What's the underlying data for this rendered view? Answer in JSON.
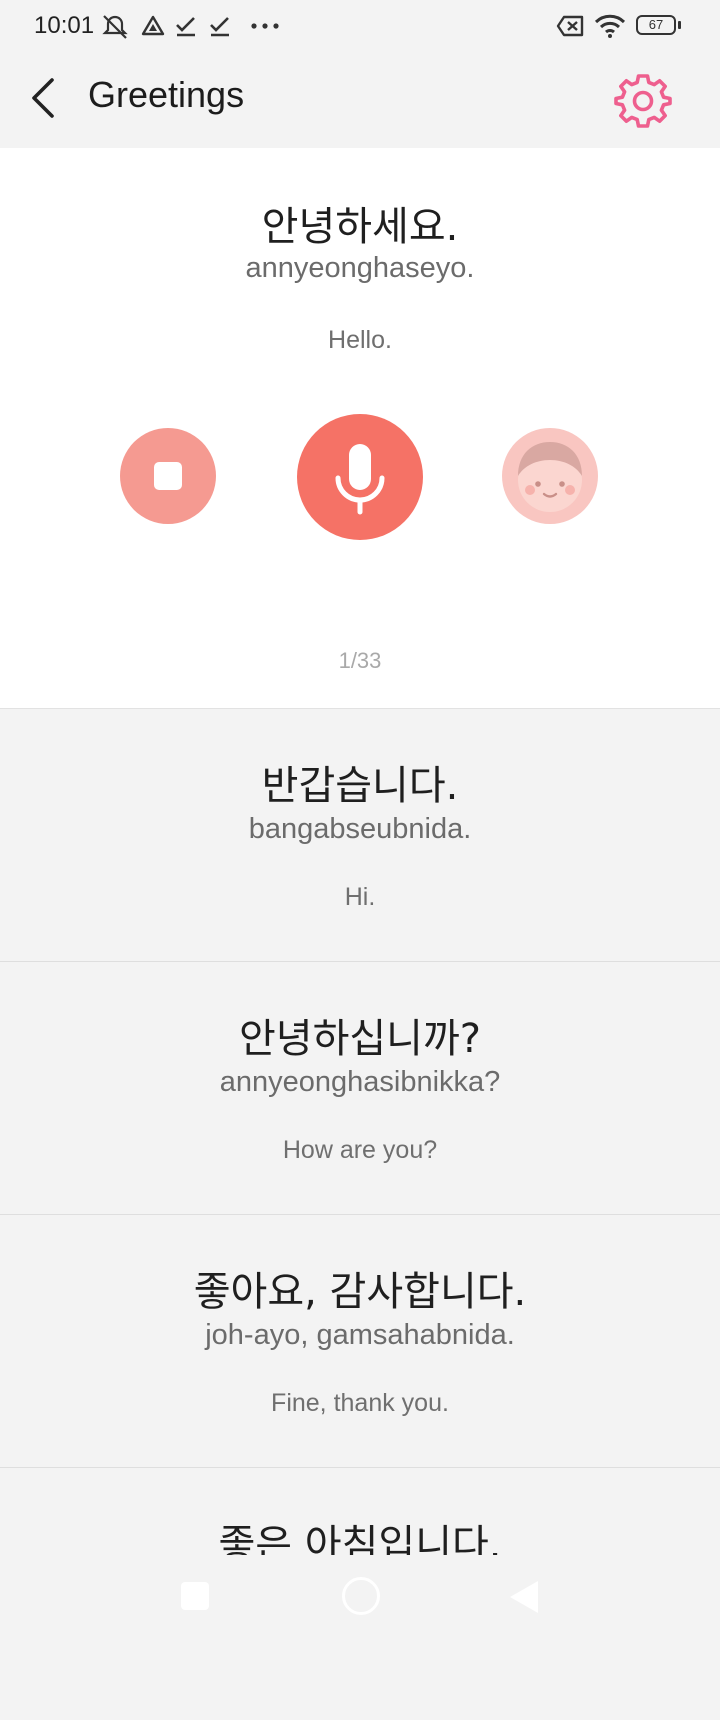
{
  "status_bar": {
    "time": "10:01",
    "battery": "67",
    "icons": [
      "mute-icon",
      "drive-icon",
      "check-icon",
      "check-icon",
      "more-icon",
      "sim-off-icon",
      "wifi-icon",
      "battery-icon"
    ]
  },
  "header": {
    "title": "Greetings",
    "back_icon": "chevron-left-icon",
    "settings_icon": "gear-icon"
  },
  "colors": {
    "accent_pink": "#ee5f8e",
    "stop_button": "#f59a91",
    "mic_button": "#f57266",
    "voice_button": "#f9c6c1"
  },
  "active_phrase": {
    "korean": "안녕하세요.",
    "romanization": "annyeonghaseyo.",
    "english": "Hello.",
    "counter": "1/33",
    "controls": [
      "stop-icon",
      "microphone-icon",
      "avatar-icon"
    ]
  },
  "phrases": [
    {
      "korean": "반갑습니다.",
      "romanization": "bangabseubnida.",
      "english": "Hi."
    },
    {
      "korean": "안녕하십니까?",
      "romanization": "annyeonghasibnikka?",
      "english": "How are you?"
    },
    {
      "korean": "좋아요, 감사합니다.",
      "romanization": "joh-ayo, gamsahabnida.",
      "english": "Fine, thank you."
    },
    {
      "korean": "좋은 아침입니다.",
      "romanization": "",
      "english": ""
    }
  ],
  "nav_bar": {
    "icons": [
      "recents-square-icon",
      "home-circle-icon",
      "back-triangle-icon"
    ]
  }
}
